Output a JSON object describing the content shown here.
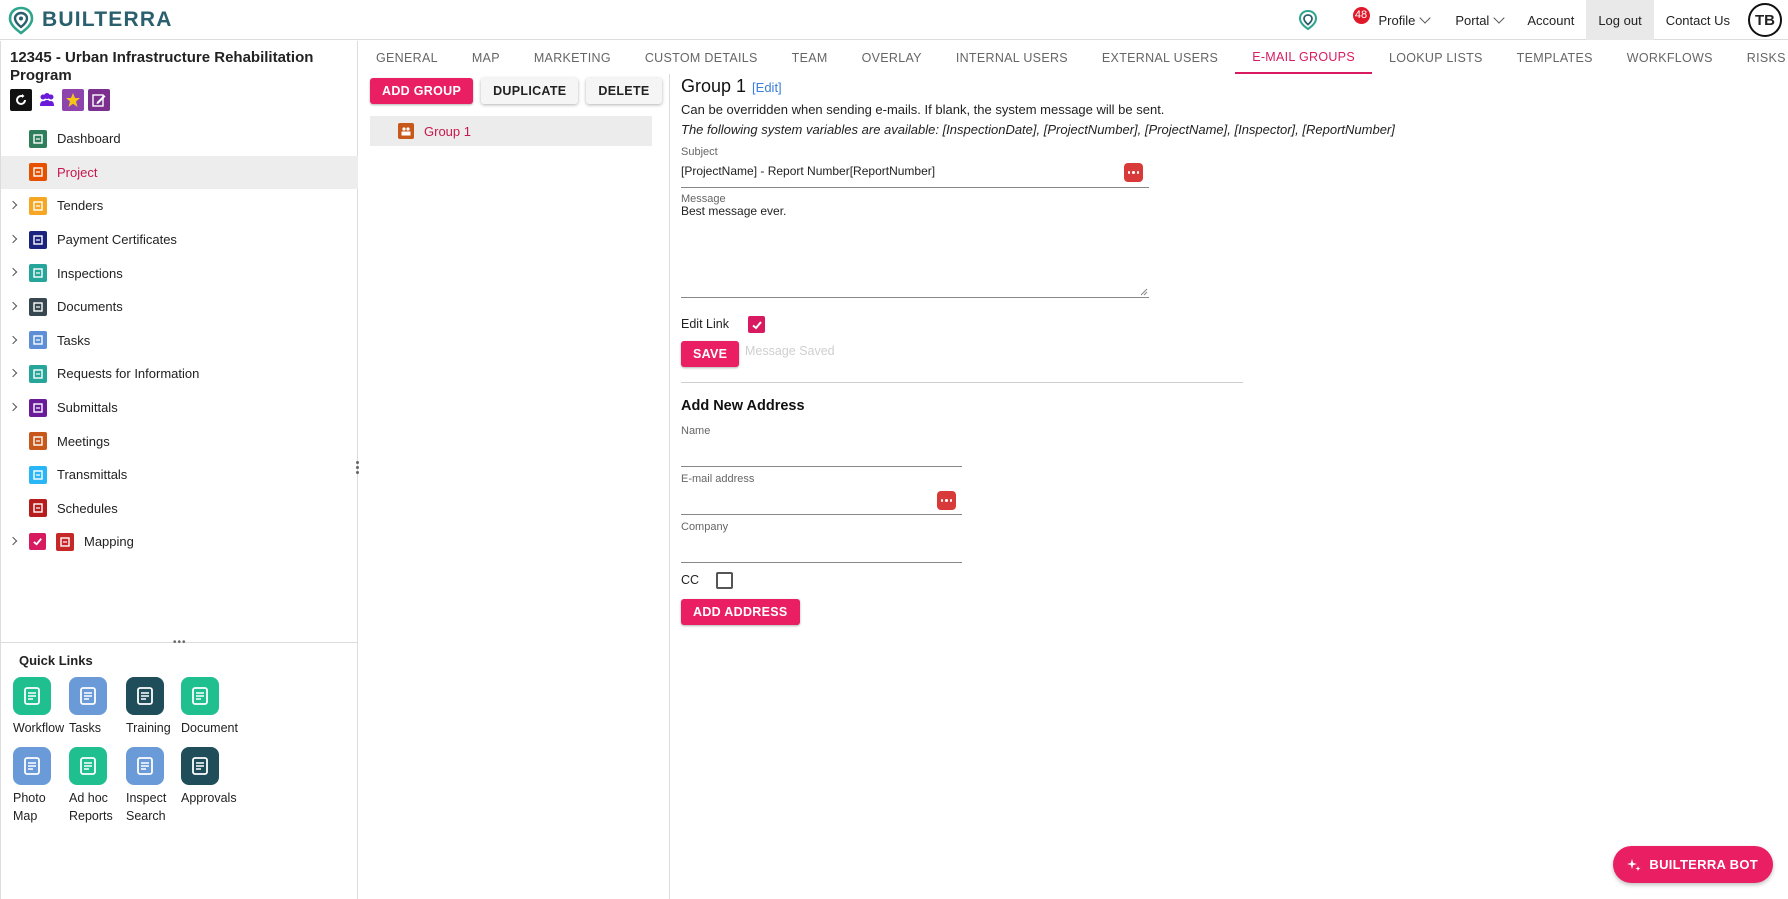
{
  "brand": {
    "name": "BUILTERRA"
  },
  "topnav": {
    "notification_count": "48",
    "profile": "Profile",
    "portal": "Portal",
    "account": "Account",
    "logout": "Log out",
    "contact": "Contact Us",
    "avatar_initials": "TB"
  },
  "project": {
    "title": "12345 - Urban Infrastructure Rehabilitation Program"
  },
  "sidebar": {
    "items": [
      {
        "label": "Dashboard",
        "icon": "dashboard-icon",
        "color": "#2e7d5b",
        "expandable": false
      },
      {
        "label": "Project",
        "icon": "project-icon",
        "color": "#e65100",
        "expandable": false
      },
      {
        "label": "Tenders",
        "icon": "tenders-icon",
        "color": "#f5a623",
        "expandable": true
      },
      {
        "label": "Payment Certificates",
        "icon": "payment-certificates-icon",
        "color": "#1a237e",
        "expandable": true
      },
      {
        "label": "Inspections",
        "icon": "inspections-icon",
        "color": "#26a69a",
        "expandable": true
      },
      {
        "label": "Documents",
        "icon": "documents-icon",
        "color": "#37474f",
        "expandable": true
      },
      {
        "label": "Tasks",
        "icon": "tasks-icon",
        "color": "#5c8fd6",
        "expandable": true
      },
      {
        "label": "Requests for Information",
        "icon": "rfi-icon",
        "color": "#26a69a",
        "expandable": true
      },
      {
        "label": "Submittals",
        "icon": "submittals-icon",
        "color": "#6a1b9a",
        "expandable": true
      },
      {
        "label": "Meetings",
        "icon": "meetings-icon",
        "color": "#c8571a",
        "expandable": false
      },
      {
        "label": "Transmittals",
        "icon": "transmittals-icon",
        "color": "#29b6f6",
        "expandable": false
      },
      {
        "label": "Schedules",
        "icon": "schedules-icon",
        "color": "#b71c1c",
        "expandable": false
      },
      {
        "label": "Mapping",
        "icon": "mapping-icon",
        "color": "#c62828",
        "expandable": true
      }
    ]
  },
  "quick_links": {
    "title": "Quick Links",
    "items": [
      {
        "label": "Workflow",
        "icon": "workflow-icon",
        "color": "#1fbf8f"
      },
      {
        "label": "Tasks",
        "icon": "tasks-icon",
        "color": "#6a9bd8"
      },
      {
        "label": "Training",
        "icon": "training-icon",
        "color": "#1f4e5a"
      },
      {
        "label": "Document",
        "icon": "document-icon",
        "color": "#1fbf8f"
      },
      {
        "label": "Photo Map",
        "icon": "photo-map-icon",
        "color": "#6a9bd8"
      },
      {
        "label": "Ad hoc Reports",
        "icon": "reports-icon",
        "color": "#1fbf8f"
      },
      {
        "label": "Inspect Search",
        "icon": "download-icon",
        "color": "#6a9bd8"
      },
      {
        "label": "Approvals",
        "icon": "approvals-icon",
        "color": "#1f4e5a"
      }
    ]
  },
  "tabs": [
    "GENERAL",
    "MAP",
    "MARKETING",
    "CUSTOM DETAILS",
    "TEAM",
    "OVERLAY",
    "INTERNAL USERS",
    "EXTERNAL USERS",
    "E-MAIL GROUPS",
    "LOOKUP LISTS",
    "TEMPLATES",
    "WORKFLOWS",
    "RISKS"
  ],
  "active_tab": "E-MAIL GROUPS",
  "groups": {
    "add_label": "ADD GROUP",
    "duplicate_label": "DUPLICATE",
    "delete_label": "DELETE",
    "items": [
      {
        "label": "Group 1"
      }
    ]
  },
  "detail": {
    "title": "Group 1",
    "edit_link": "[Edit]",
    "info_line": "Can be overridden when sending e-mails. If blank, the system message will be sent.",
    "variables_line": "The following system variables are available: [InspectionDate], [ProjectNumber], [ProjectName], [Inspector], [ReportNumber]",
    "subject_label": "Subject",
    "subject_value": "[ProjectName] - Report Number[ReportNumber]",
    "message_label": "Message",
    "message_value": "Best message ever.",
    "edit_link_label": "Edit Link",
    "edit_link_checked": true,
    "save_label": "SAVE",
    "saved_status": "Message Saved"
  },
  "add_address": {
    "title": "Add New Address",
    "name_label": "Name",
    "name_value": "",
    "email_label": "E-mail address",
    "email_value": "",
    "company_label": "Company",
    "company_value": "",
    "cc_label": "CC",
    "cc_checked": false,
    "add_label": "ADD ADDRESS"
  },
  "bot": {
    "label": "BUILTERRA BOT"
  },
  "colors": {
    "accent": "#e91e63",
    "active_text": "#c8174e",
    "brand": "#2a5f6e",
    "link": "#3b7dd8"
  }
}
